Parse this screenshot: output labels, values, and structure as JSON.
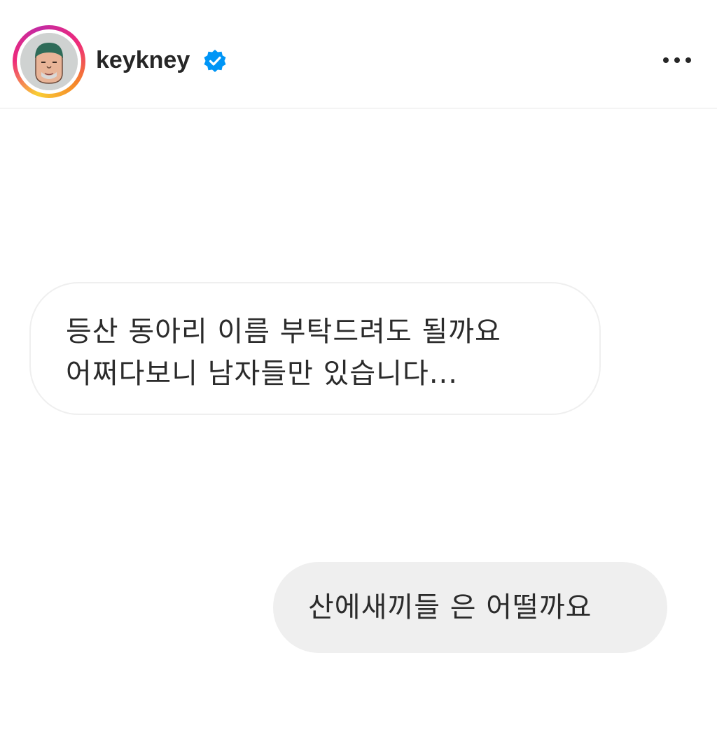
{
  "header": {
    "username": "keykney",
    "verified_icon": "verified-badge-icon",
    "more_icon": "more-options-icon",
    "avatar_ring_colors": [
      "#f9ce34",
      "#ee2a7b",
      "#c32aa3",
      "#f58529"
    ],
    "verified_color": "#0095f6"
  },
  "messages": [
    {
      "direction": "received",
      "lines": [
        "등산 동아리 이름 부탁드려도 될까요",
        "어쩌다보니 남자들만 있습니다..."
      ]
    },
    {
      "direction": "sent",
      "lines": [
        "산에새끼들 은 어떨까요"
      ]
    }
  ]
}
